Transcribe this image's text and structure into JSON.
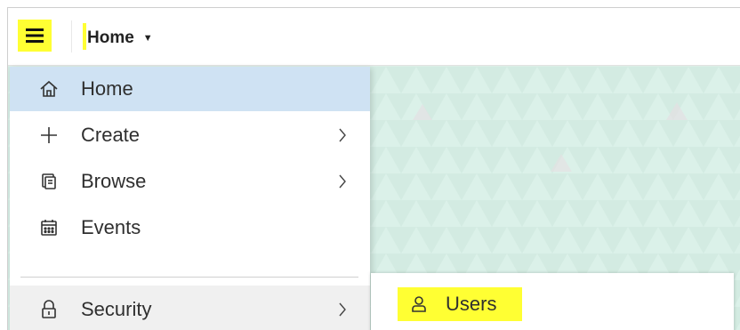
{
  "header": {
    "menu_icon": "hamburger-icon",
    "dropdown_label": "Home",
    "dropdown_caret": "▼"
  },
  "nav": {
    "items": [
      {
        "label": "Home",
        "icon": "house-icon",
        "active": true
      },
      {
        "label": "Create",
        "icon": "plus-icon",
        "has_submenu": true
      },
      {
        "label": "Browse",
        "icon": "browse-icon",
        "has_submenu": true
      },
      {
        "label": "Events",
        "icon": "calendar-icon"
      },
      {
        "label": "Security",
        "icon": "lock-icon",
        "has_submenu": true
      }
    ]
  },
  "submenu": {
    "items": [
      {
        "label": "Users",
        "icon": "user-icon"
      }
    ]
  },
  "colors": {
    "highlight": "#ffff33",
    "active_item": "#cfe2f3",
    "background": "#d8eee6"
  }
}
